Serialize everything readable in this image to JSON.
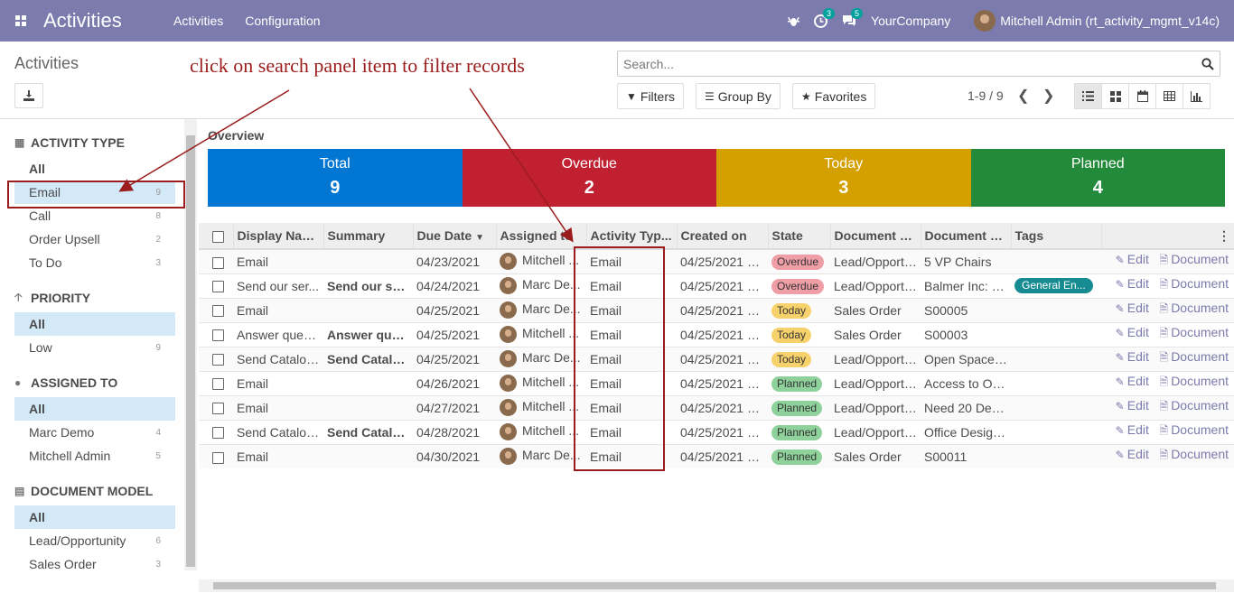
{
  "navbar": {
    "app_title": "Activities",
    "menu": [
      "Activities",
      "Configuration"
    ],
    "activity_badge": "3",
    "message_badge": "5",
    "company": "YourCompany",
    "user": "Mitchell Admin (rt_activity_mgmt_v14c)"
  },
  "control_panel": {
    "breadcrumb": "Activities",
    "search_placeholder": "Search...",
    "filters_label": "Filters",
    "groupby_label": "Group By",
    "favorites_label": "Favorites",
    "pager": "1-9 / 9"
  },
  "annotation": "click on search panel item to filter records",
  "side_panel": {
    "sections": [
      {
        "title": "ACTIVITY TYPE",
        "icon": "grid-icon",
        "items": [
          {
            "label": "All",
            "count": ""
          },
          {
            "label": "Email",
            "count": "9"
          },
          {
            "label": "Call",
            "count": "8"
          },
          {
            "label": "Order Upsell",
            "count": "2"
          },
          {
            "label": "To Do",
            "count": "3"
          }
        ]
      },
      {
        "title": "PRIORITY",
        "icon": "arrow-up-icon",
        "items": [
          {
            "label": "All",
            "count": ""
          },
          {
            "label": "Low",
            "count": "9"
          }
        ]
      },
      {
        "title": "ASSIGNED TO",
        "icon": "users-icon",
        "items": [
          {
            "label": "All",
            "count": ""
          },
          {
            "label": "Marc Demo",
            "count": "4"
          },
          {
            "label": "Mitchell Admin",
            "count": "5"
          }
        ]
      },
      {
        "title": "DOCUMENT MODEL",
        "icon": "file-icon",
        "items": [
          {
            "label": "All",
            "count": ""
          },
          {
            "label": "Lead/Opportunity",
            "count": "6"
          },
          {
            "label": "Sales Order",
            "count": "3"
          }
        ]
      }
    ]
  },
  "overview": {
    "title": "Overview",
    "tiles": [
      {
        "label": "Total",
        "value": "9",
        "color": "#0176d3"
      },
      {
        "label": "Overdue",
        "value": "2",
        "color": "#c02030"
      },
      {
        "label": "Today",
        "value": "3",
        "color": "#d4a000"
      },
      {
        "label": "Planned",
        "value": "4",
        "color": "#228a3a"
      }
    ]
  },
  "table": {
    "columns": [
      "Display Name",
      "Summary",
      "Due Date",
      "Assigned to",
      "Activity Typ...",
      "Created on",
      "State",
      "Document M...",
      "Document N...",
      "Tags"
    ],
    "edit_label": "Edit",
    "document_label": "Document",
    "rows": [
      {
        "name": "Email",
        "summary": "",
        "due": "04/23/2021",
        "assigned": "Mitchell ...",
        "type": "Email",
        "created": "04/25/2021 1...",
        "state": "Overdue",
        "model": "Lead/Opportu...",
        "doc": "5 VP Chairs",
        "tag": ""
      },
      {
        "name": "Send our ser...",
        "summary": "Send our ser...",
        "due": "04/24/2021",
        "assigned": "Marc De...",
        "type": "Email",
        "created": "04/25/2021 1...",
        "state": "Overdue",
        "model": "Lead/Opportu...",
        "doc": "Balmer Inc: P...",
        "tag": "General En..."
      },
      {
        "name": "Email",
        "summary": "",
        "due": "04/25/2021",
        "assigned": "Marc De...",
        "type": "Email",
        "created": "04/25/2021 1...",
        "state": "Today",
        "model": "Sales Order",
        "doc": "S00005",
        "tag": ""
      },
      {
        "name": "Answer quest...",
        "summary": "Answer que...",
        "due": "04/25/2021",
        "assigned": "Mitchell ...",
        "type": "Email",
        "created": "04/25/2021 1...",
        "state": "Today",
        "model": "Sales Order",
        "doc": "S00003",
        "tag": ""
      },
      {
        "name": "Send Catalog...",
        "summary": "Send Catalo...",
        "due": "04/25/2021",
        "assigned": "Marc De...",
        "type": "Email",
        "created": "04/25/2021 1...",
        "state": "Today",
        "model": "Lead/Opportu...",
        "doc": "Open Space ...",
        "tag": ""
      },
      {
        "name": "Email",
        "summary": "",
        "due": "04/26/2021",
        "assigned": "Mitchell ...",
        "type": "Email",
        "created": "04/25/2021 1...",
        "state": "Planned",
        "model": "Lead/Opportu...",
        "doc": "Access to On...",
        "tag": ""
      },
      {
        "name": "Email",
        "summary": "",
        "due": "04/27/2021",
        "assigned": "Mitchell ...",
        "type": "Email",
        "created": "04/25/2021 1...",
        "state": "Planned",
        "model": "Lead/Opportu...",
        "doc": "Need 20 Desks",
        "tag": ""
      },
      {
        "name": "Send Catalog...",
        "summary": "Send Catalo...",
        "due": "04/28/2021",
        "assigned": "Mitchell ...",
        "type": "Email",
        "created": "04/25/2021 1...",
        "state": "Planned",
        "model": "Lead/Opportu...",
        "doc": "Office Design...",
        "tag": ""
      },
      {
        "name": "Email",
        "summary": "",
        "due": "04/30/2021",
        "assigned": "Marc De...",
        "type": "Email",
        "created": "04/25/2021 1...",
        "state": "Planned",
        "model": "Sales Order",
        "doc": "S00011",
        "tag": ""
      }
    ]
  }
}
